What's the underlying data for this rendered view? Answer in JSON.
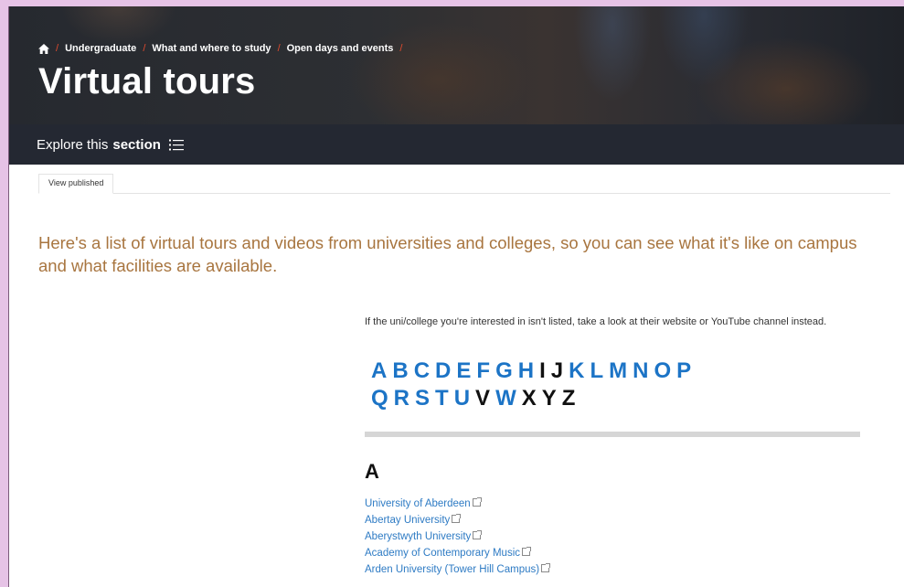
{
  "breadcrumb": {
    "items": [
      "Undergraduate",
      "What and where to study",
      "Open days and events"
    ],
    "separator": "/"
  },
  "page": {
    "title": "Virtual tours"
  },
  "explore": {
    "prefix": "Explore this",
    "bold": "section"
  },
  "tabs": [
    {
      "label": "View published"
    }
  ],
  "intro": "Here's a list of virtual tours and videos from universities and colleges, so you can see what it's like on campus and what facilities are available.",
  "note": "If the uni/college you're interested in isn't listed, take a look at their website or YouTube channel instead.",
  "alphabet": {
    "row1": [
      {
        "l": "A",
        "on": true
      },
      {
        "l": "B",
        "on": true
      },
      {
        "l": "C",
        "on": true
      },
      {
        "l": "D",
        "on": true
      },
      {
        "l": "E",
        "on": true
      },
      {
        "l": "F",
        "on": true
      },
      {
        "l": "G",
        "on": true
      },
      {
        "l": "H",
        "on": true
      },
      {
        "l": "I",
        "on": false
      },
      {
        "l": "J",
        "on": false
      },
      {
        "l": "K",
        "on": true
      },
      {
        "l": "L",
        "on": true
      },
      {
        "l": "M",
        "on": true
      },
      {
        "l": "N",
        "on": true
      },
      {
        "l": "O",
        "on": true
      },
      {
        "l": "P",
        "on": true
      }
    ],
    "row2": [
      {
        "l": "Q",
        "on": true
      },
      {
        "l": "R",
        "on": true
      },
      {
        "l": "S",
        "on": true
      },
      {
        "l": "T",
        "on": true
      },
      {
        "l": "U",
        "on": true
      },
      {
        "l": "V",
        "on": false
      },
      {
        "l": "W",
        "on": true
      },
      {
        "l": "X",
        "on": false
      },
      {
        "l": "Y",
        "on": false
      },
      {
        "l": "Z",
        "on": false
      }
    ]
  },
  "section": {
    "letter": "A",
    "items": [
      "University of Aberdeen",
      "Abertay University",
      "Aberystwyth University",
      "Academy of Contemporary Music",
      "Arden University (Tower Hill Campus)"
    ]
  },
  "colors": {
    "link": "#1c74c6",
    "accent_red": "#e24b2e",
    "intro_text": "#a8753f",
    "explore_bar": "#242832"
  },
  "icons": {
    "home": "home-icon",
    "section_menu": "list-icon",
    "external": "external-link-icon"
  }
}
